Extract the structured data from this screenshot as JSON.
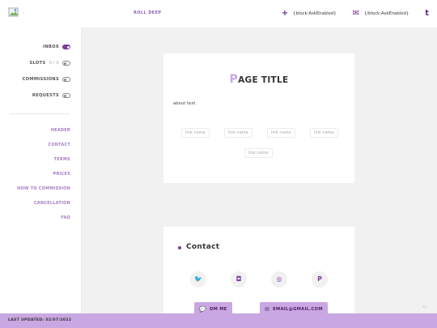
{
  "topbar": {
    "logo_icon": "broken-image-icon",
    "logo_caption": "‹",
    "brand": "ROLL DEEP",
    "actions": [
      {
        "icon": "plus-icon",
        "glyph": "+",
        "label": "{block:AskEnabled}"
      },
      {
        "icon": "envelope-icon",
        "glyph": "✉",
        "label": "{/block:AskEnabled}"
      },
      {
        "icon": "tumblr-icon",
        "glyph": "t"
      }
    ]
  },
  "sidebar": {
    "toggles": [
      {
        "label": "INBOX",
        "on": true
      },
      {
        "label": "SLOTS",
        "count": "0 / 0",
        "on": false
      },
      {
        "label": "COMMISSIONS",
        "on": false
      },
      {
        "label": "REQUESTS",
        "on": false
      }
    ],
    "links": [
      "HEADER",
      "CONTACT",
      "TERMS",
      "PRICES",
      "HOW TO COMMISSION",
      "CANCELLATION",
      "FAQ"
    ]
  },
  "page": {
    "title_first": "P",
    "title_rest": "AGE TITLE",
    "about": "about text",
    "chips": [
      "link name",
      "link name",
      "link name",
      "link name",
      "link name"
    ]
  },
  "contact": {
    "title": "Contact",
    "socials": [
      {
        "icon": "twitter-icon",
        "glyph": "🐦"
      },
      {
        "icon": "instagram-icon",
        "glyph": "◘"
      },
      {
        "icon": "twitch-icon",
        "glyph": "◎"
      },
      {
        "icon": "paypal-icon",
        "glyph": "P"
      }
    ],
    "dm_label": "DM ME",
    "email_label": "EMAIL@GMAIL.COM"
  },
  "corner_text": "aa",
  "footer": {
    "text": "LAST UPDATED: 02/07/2022"
  },
  "colors": {
    "accent": "#7a3ba0",
    "accent_light": "#c9a7e2",
    "link": "#a57cc4"
  }
}
